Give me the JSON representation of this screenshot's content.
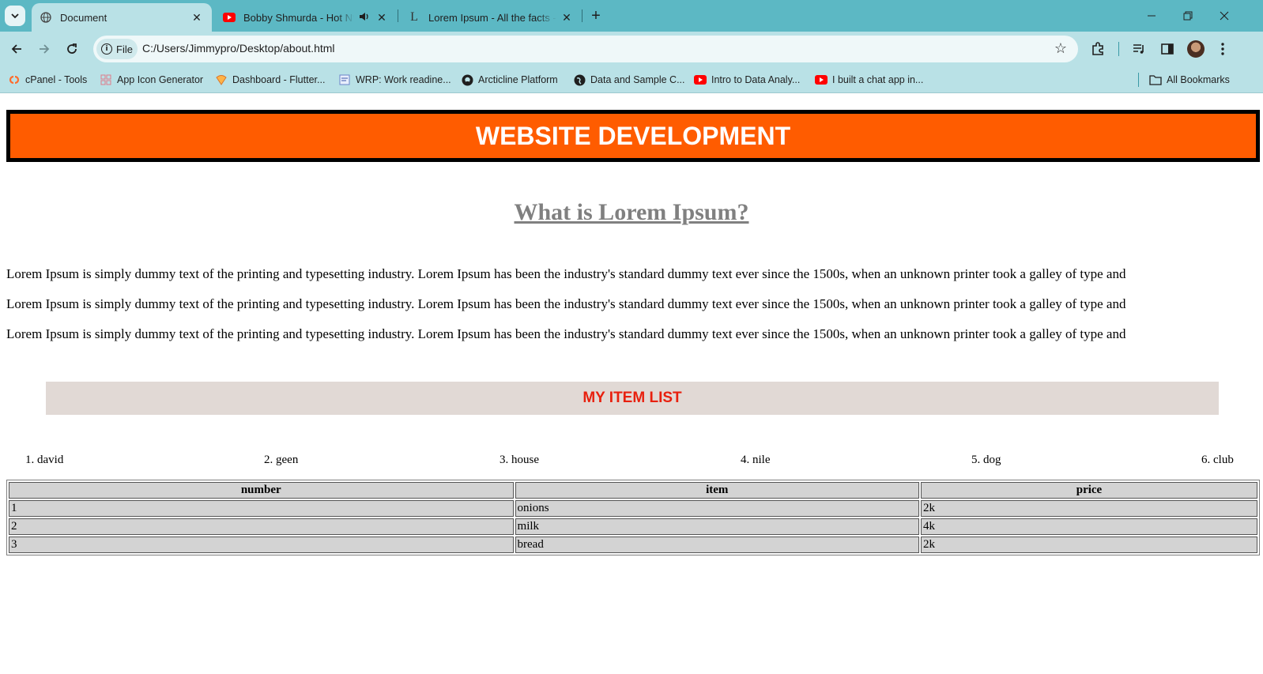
{
  "browser": {
    "tabs": [
      {
        "title": "Document",
        "active": true,
        "icon": "globe-icon"
      },
      {
        "title": "Bobby Shmurda - Hot N*gga",
        "active": false,
        "icon": "youtube-icon",
        "audio": true
      },
      {
        "title": "Lorem Ipsum - All the facts - Lipsum",
        "active": false,
        "icon": "lipsum-icon"
      }
    ],
    "chip_label": "File",
    "url": "C:/Users/Jimmypro/Desktop/about.html",
    "bookmarks": [
      {
        "label": "cPanel - Tools",
        "icon": "cpanel-icon"
      },
      {
        "label": "App Icon Generator",
        "icon": "app-icon-generator-icon"
      },
      {
        "label": "Dashboard - Flutter...",
        "icon": "flutter-dashboard-icon"
      },
      {
        "label": "WRP: Work readine...",
        "icon": "wrp-icon"
      },
      {
        "label": "Arcticline Platform",
        "icon": "github-icon"
      },
      {
        "label": "Data and Sample C...",
        "icon": "globe-icon"
      },
      {
        "label": "Intro to Data Analy...",
        "icon": "youtube-icon"
      },
      {
        "label": "I built a chat app in...",
        "icon": "youtube-icon"
      }
    ],
    "all_bookmarks": "All Bookmarks",
    "colors": {
      "frame": "#5cb8c4",
      "toolbar": "#b9e1e6"
    }
  },
  "page": {
    "banner_title": "WEBSITE DEVELOPMENT",
    "heading": "What is Lorem Ipsum?",
    "paragraphs": [
      "Lorem Ipsum is simply dummy text of the printing and typesetting industry. Lorem Ipsum has been the industry's standard dummy text ever since the 1500s, when an unknown printer took a galley of type and",
      "Lorem Ipsum is simply dummy text of the printing and typesetting industry. Lorem Ipsum has been the industry's standard dummy text ever since the 1500s, when an unknown printer took a galley of type and",
      "Lorem Ipsum is simply dummy text of the printing and typesetting industry. Lorem Ipsum has been the industry's standard dummy text ever since the 1500s, when an unknown printer took a galley of type and"
    ],
    "item_list_title": "MY ITEM LIST",
    "items": [
      "1. david",
      "2. geen",
      "3. house",
      "4. nile",
      "5. dog",
      "6. club"
    ],
    "table": {
      "headers": [
        "number",
        "item",
        "price"
      ],
      "rows": [
        [
          "1",
          "onions",
          "2k"
        ],
        [
          "2",
          "milk",
          "4k"
        ],
        [
          "3",
          "bread",
          "2k"
        ]
      ]
    },
    "colors": {
      "banner_bg": "#ff5c00",
      "heading": "#808080",
      "item_banner_bg": "#e1d9d5",
      "item_banner_text": "#e8200e",
      "table_cell": "#d3d3d3"
    }
  }
}
